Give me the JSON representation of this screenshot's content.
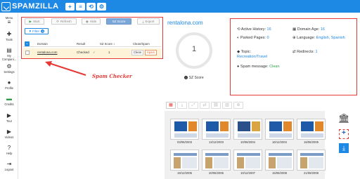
{
  "app": {
    "name": "SPAMZILLA"
  },
  "topbar": {
    "btn_add": "+",
    "btn_list": "≡",
    "btn_history": "⟲",
    "btn_gear": "⚙"
  },
  "sidebar": {
    "menu_label": "Menu",
    "items": [
      {
        "label": "Tools",
        "icon": "tools-icon",
        "glyph": "✚"
      },
      {
        "label": "My Compani...",
        "icon": "folder-icon",
        "glyph": "▤"
      },
      {
        "label": "Settings",
        "icon": "gear-icon",
        "glyph": "⚙"
      },
      {
        "label": "Profile",
        "icon": "user-icon",
        "glyph": "●"
      },
      {
        "label": "Credits",
        "icon": "credits-icon",
        "glyph": "▬"
      },
      {
        "label": "Tour",
        "icon": "tour-icon",
        "glyph": "▶"
      },
      {
        "label": "Videos",
        "icon": "video-icon",
        "glyph": "▶"
      },
      {
        "label": "Help",
        "icon": "help-icon",
        "glyph": "?"
      },
      {
        "label": "Logout",
        "icon": "logout-icon",
        "glyph": "⇥"
      }
    ]
  },
  "toolbar": {
    "start": "Start",
    "refresh": "Refresh",
    "hide": "Hide",
    "sz_score": "SZ Score",
    "export": "Export",
    "filter": "Filter",
    "filter_count": "0"
  },
  "table": {
    "headers": {
      "domain": "Domain",
      "result": "Result",
      "sz_score": "SZ Score ↕",
      "clean_spam": "Clean/Spam"
    },
    "rows": [
      {
        "domain": "rentalona.com",
        "result": "Checked",
        "check": "✓",
        "score": "1",
        "clean": "Clean",
        "spam": "Spam"
      }
    ]
  },
  "annotation": {
    "label": "Spam Checker"
  },
  "summary": {
    "domain": "rentalona.com",
    "score": "1",
    "score_label": "SZ Score"
  },
  "details": {
    "active_history": {
      "label": "Active History:",
      "value": "16"
    },
    "domain_age": {
      "label": "Domain Age:",
      "value": "16"
    },
    "parked_pages": {
      "label": "Parked Pages:",
      "value": "0"
    },
    "language": {
      "label": "Language:",
      "value": "English, Spanish"
    },
    "topic": {
      "label": "Topic:",
      "value": "Recreation/Travel"
    },
    "redirects": {
      "label": "Redirects:",
      "value": "1"
    },
    "spam_message": {
      "label": "Spam message:",
      "value": "Clean"
    }
  },
  "history": {
    "row1": [
      "03/06/2003",
      "13/12/2003",
      "10/06/2004",
      "16/12/2004",
      "16/06/2005"
    ],
    "row2": [
      "19/12/2005",
      "20/06/2006",
      "10/12/2007",
      "15/06/2008",
      "21/09/2008"
    ]
  },
  "colors": {
    "brand": "#1e88e5",
    "annotation": "#e53935",
    "clean": "#2e9d4a"
  }
}
